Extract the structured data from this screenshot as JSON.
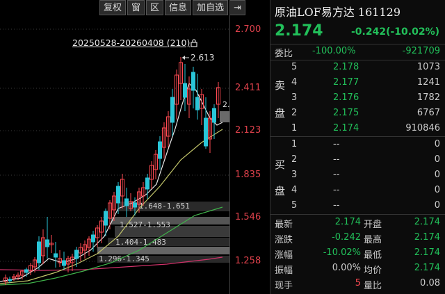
{
  "toolbar": {
    "buttons": [
      "复权",
      "窗",
      "区",
      "信息",
      "加自选",
      "⇥"
    ]
  },
  "chart": {
    "date_range": "20250528-20260408 (210)",
    "price_labels": [
      "2.700",
      "2.411",
      "2.123",
      "1.835",
      "1.546",
      "1.258"
    ],
    "high_marker": "2.613",
    "edge_value": "2.",
    "range_labels": [
      "1.648-1.651",
      "1.527-1.553",
      "1.404-1.483",
      "1.296-1.345"
    ]
  },
  "quote": {
    "title": "原油LOF易方达 161129",
    "price": "2.174",
    "change": "-0.242(-10.02%)",
    "weibi": {
      "label": "委比",
      "pct": "-100.00%",
      "diff": "-921709"
    },
    "sell_label": [
      "卖",
      "盘"
    ],
    "buy_label": [
      "买",
      "盘"
    ],
    "sell": [
      {
        "level": "5",
        "price": "2.178",
        "volume": "1073"
      },
      {
        "level": "4",
        "price": "2.177",
        "volume": "1241"
      },
      {
        "level": "3",
        "price": "2.176",
        "volume": "1782"
      },
      {
        "level": "2",
        "price": "2.175",
        "volume": "6767"
      },
      {
        "level": "1",
        "price": "2.174",
        "volume": "910846"
      }
    ],
    "buy": [
      {
        "level": "1",
        "price": "--",
        "volume": "0"
      },
      {
        "level": "2",
        "price": "--",
        "volume": "0"
      },
      {
        "level": "3",
        "price": "--",
        "volume": "0"
      },
      {
        "level": "4",
        "price": "--",
        "volume": "0"
      },
      {
        "level": "5",
        "price": "--",
        "volume": "0"
      }
    ],
    "stats": [
      {
        "l1": "最新",
        "v1": "2.174",
        "l2": "开盘",
        "v2": "2.174"
      },
      {
        "l1": "涨跌",
        "v1": "-0.242",
        "l2": "最高",
        "v2": "2.174"
      },
      {
        "l1": "涨幅",
        "v1": "-10.02%",
        "l2": "最低",
        "v2": "2.174"
      },
      {
        "l1": "振幅",
        "v1": "0.00%",
        "l2": "均价",
        "v2": "2.174"
      },
      {
        "l1": "现手",
        "v1": "5",
        "l2": "量比",
        "v2": "0.08"
      }
    ]
  },
  "colors": {
    "up": "#ff4a52",
    "down": "#22c05a",
    "candle_down": "#29c6d8"
  }
}
